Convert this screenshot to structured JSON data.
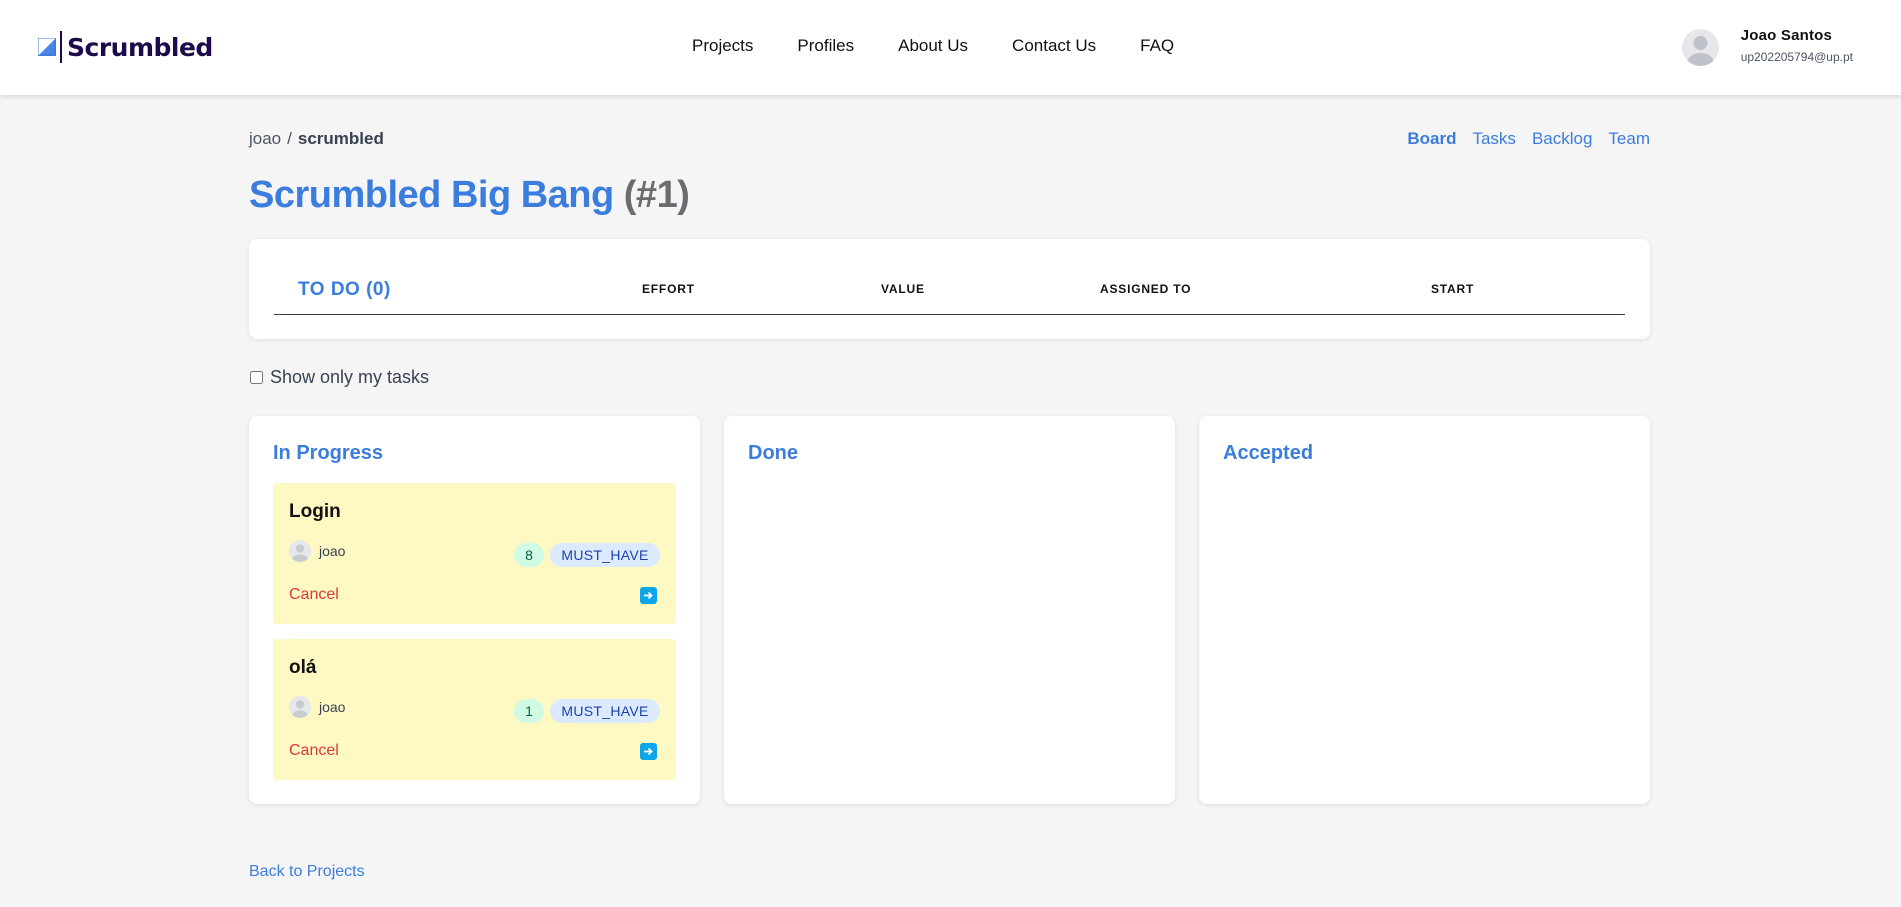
{
  "header": {
    "logo_text": "Scrumbled",
    "nav": [
      "Projects",
      "Profiles",
      "About Us",
      "Contact Us",
      "FAQ"
    ],
    "user": {
      "name": "Joao Santos",
      "email": "up202205794@up.pt"
    }
  },
  "breadcrumb": {
    "owner": "joao",
    "separator": "/",
    "project": "scrumbled"
  },
  "tabs": [
    "Board",
    "Tasks",
    "Backlog",
    "Team"
  ],
  "active_tab": "Board",
  "sprint": {
    "name": "Scrumbled Big Bang",
    "number": "(#1)"
  },
  "todo": {
    "title": "TO DO (0)",
    "columns": [
      "EFFORT",
      "VALUE",
      "ASSIGNED TO",
      "START"
    ]
  },
  "filter": {
    "label": "Show only my tasks",
    "checked": false
  },
  "columns": [
    {
      "title": "In Progress",
      "tasks": [
        {
          "name": "Login",
          "assignee": "joao",
          "effort": "8",
          "value": "MUST_HAVE",
          "cancel": "Cancel"
        },
        {
          "name": "olá",
          "assignee": "joao",
          "effort": "1",
          "value": "MUST_HAVE",
          "cancel": "Cancel"
        }
      ]
    },
    {
      "title": "Done",
      "tasks": []
    },
    {
      "title": "Accepted",
      "tasks": []
    }
  ],
  "back_link": "Back to Projects",
  "colors": {
    "accent": "#3b7ddd",
    "brand": "#1e0a4a",
    "task_bg": "#fef8c3",
    "cancel": "#dc3a3a",
    "effort_bg": "#d1fae5",
    "priority_bg": "#dbeafe"
  }
}
